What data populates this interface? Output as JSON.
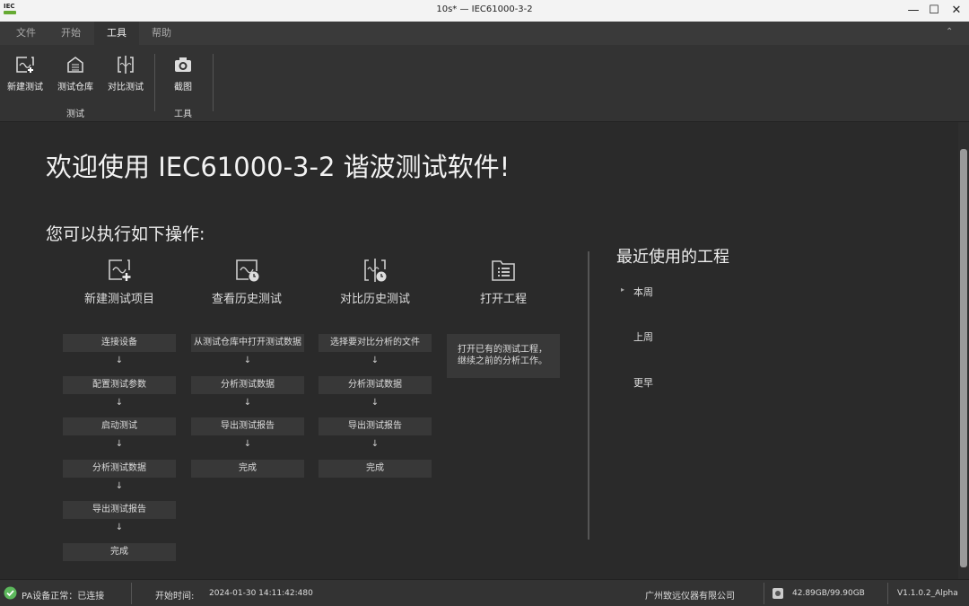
{
  "window": {
    "title": "10s* — IEC61000-3-2",
    "logo": "IEC",
    "min": "—",
    "max": "☐",
    "close": "✕"
  },
  "menu_tabs": [
    "文件",
    "开始",
    "工具",
    "帮助"
  ],
  "ribbon": {
    "buttons": [
      "新建测试",
      "测试仓库",
      "对比测试",
      "截图"
    ],
    "groups": [
      "测试",
      "工具"
    ],
    "collapse": "⌃"
  },
  "main": {
    "welcome": "欢迎使用 IEC61000-3-2 谐波测试软件!",
    "subtitle": "您可以执行如下操作:",
    "columns": [
      {
        "title": "新建测试项目",
        "steps": [
          "连接设备",
          "配置测试参数",
          "启动测试",
          "分析测试数据",
          "导出测试报告",
          "完成"
        ]
      },
      {
        "title": "查看历史测试",
        "steps": [
          "从测试仓库中打开测试数据",
          "分析测试数据",
          "导出测试报告",
          "完成"
        ]
      },
      {
        "title": "对比历史测试",
        "steps": [
          "选择要对比分析的文件",
          "分析测试数据",
          "导出测试报告",
          "完成"
        ]
      },
      {
        "title": "打开工程",
        "description": "打开已有的测试工程，继续之前的分析工作。"
      }
    ],
    "arrow": "↓"
  },
  "recent": {
    "title": "最近使用的工程",
    "groups": [
      "本周",
      "上周",
      "更早"
    ],
    "expander": "▸"
  },
  "status": {
    "device": "PA设备正常：已连接",
    "start_label": "开始时间:",
    "start_time": "2024-01-30 14:11:42:480",
    "company": "广州致远仪器有限公司",
    "disk": "42.89GB/99.90GB",
    "version": "V1.1.0.2_Alpha"
  },
  "colors": {
    "ok": "#5cb85c",
    "bg": "#2a2a2a"
  }
}
